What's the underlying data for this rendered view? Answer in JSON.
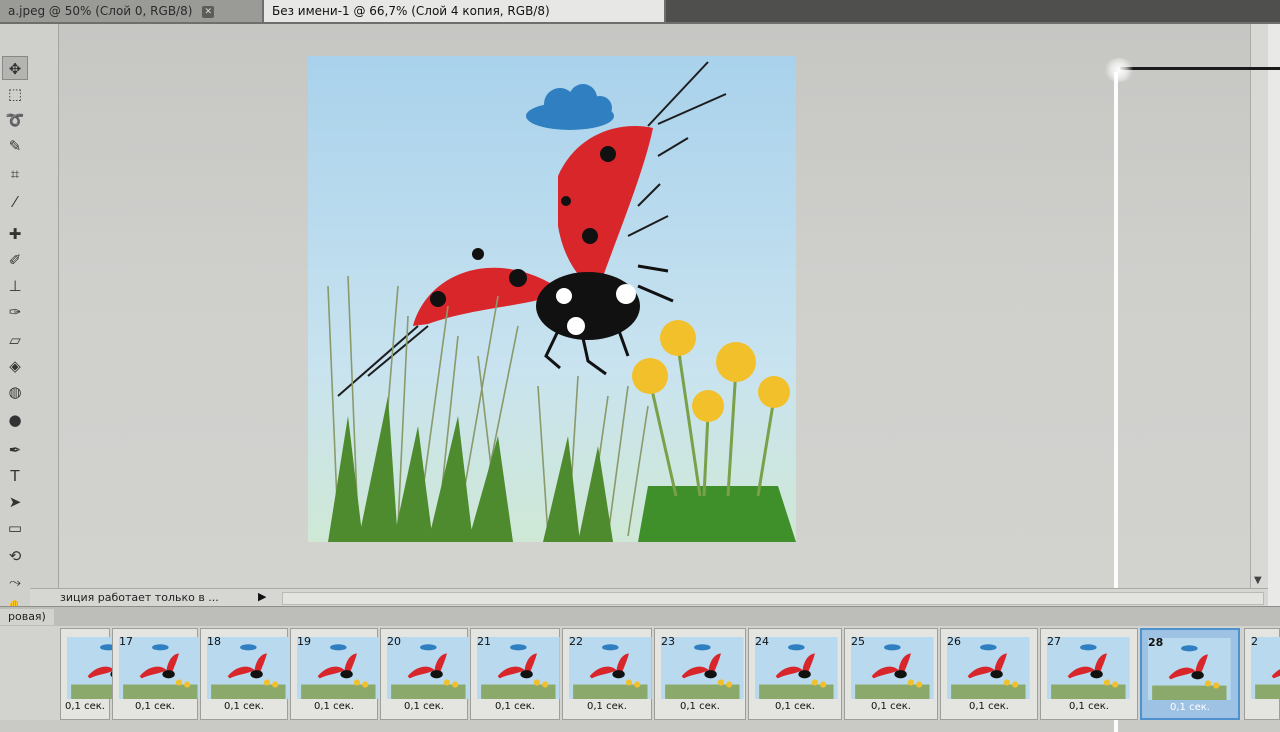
{
  "tabs": {
    "inactive_label": "а.jpeg @ 50% (Слой 0, RGB/8)",
    "active_label": "Без имени-1 @ 66,7% (Слой 4 копия, RGB/8)",
    "close_glyph": "✕"
  },
  "toolbox": {
    "tools": [
      "move",
      "marquee",
      "lasso",
      "quick-select",
      "crop",
      "eyedropper",
      "healing",
      "brush",
      "stamp",
      "history-brush",
      "eraser",
      "paint-bucket",
      "dodge",
      "zoom-tool",
      "pen",
      "type",
      "path-select",
      "shape",
      "3d-rotate",
      "3d-camera",
      "hand",
      "zoom"
    ],
    "type_glyph": "T",
    "foreground_color": "#111111",
    "background_color": "#3b8a5b"
  },
  "status": {
    "text": "зиция работает только в ...",
    "play_glyph": "▶"
  },
  "animation": {
    "panel_title": "ровая)",
    "frames": [
      {
        "num": "",
        "delay": "0,1 сек."
      },
      {
        "num": "17",
        "delay": "0,1 сек."
      },
      {
        "num": "18",
        "delay": "0,1 сек."
      },
      {
        "num": "19",
        "delay": "0,1 сек."
      },
      {
        "num": "20",
        "delay": "0,1 сек."
      },
      {
        "num": "21",
        "delay": "0,1 сек."
      },
      {
        "num": "22",
        "delay": "0,1 сек."
      },
      {
        "num": "23",
        "delay": "0,1 сек."
      },
      {
        "num": "24",
        "delay": "0,1 сек."
      },
      {
        "num": "25",
        "delay": "0,1 сек."
      },
      {
        "num": "26",
        "delay": "0,1 сек."
      },
      {
        "num": "27",
        "delay": "0,1 сек."
      },
      {
        "num": "28",
        "delay": "0,1 сек.",
        "selected": true
      },
      {
        "num": "2",
        "delay": ""
      }
    ]
  },
  "colors": {
    "ladybug_red": "#d8262b",
    "sky": "#b9d9ee",
    "cloud": "#2f7fc1",
    "dandelion": "#f2c02a",
    "selection_blue": "#4f91cf"
  }
}
